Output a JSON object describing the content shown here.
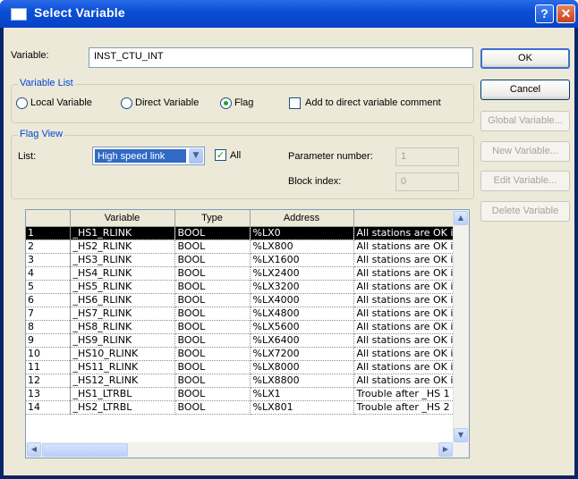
{
  "window": {
    "title": "Select Variable",
    "help_glyph": "?",
    "close_glyph": "✕"
  },
  "variable": {
    "label": "Variable:",
    "value": "INST_CTU_INT"
  },
  "variable_list": {
    "title": "Variable List",
    "options": [
      "Local Variable",
      "Direct Variable",
      "Flag"
    ],
    "selected": "Flag",
    "add_comment_label": "Add to direct variable comment",
    "add_comment_checked": false
  },
  "flag_view": {
    "title": "Flag View",
    "list_label": "List:",
    "list_value": "High speed link",
    "all_label": "All",
    "all_checked": true,
    "param_label": "Parameter number:",
    "param_value": "1",
    "block_label": "Block index:",
    "block_value": "0"
  },
  "buttons": {
    "ok": "OK",
    "cancel": "Cancel",
    "global": "Global Variable...",
    "new": "New Variable...",
    "edit": "Edit Variable...",
    "delete": "Delete Variable"
  },
  "table": {
    "columns": [
      "",
      "Variable",
      "Type",
      "Address",
      ""
    ],
    "rows": [
      [
        "1",
        "_HS1_RLINK",
        "BOOL",
        "%LX0",
        "All stations are OK i"
      ],
      [
        "2",
        "_HS2_RLINK",
        "BOOL",
        "%LX800",
        "All stations are OK i"
      ],
      [
        "3",
        "_HS3_RLINK",
        "BOOL",
        "%LX1600",
        "All stations are OK i"
      ],
      [
        "4",
        "_HS4_RLINK",
        "BOOL",
        "%LX2400",
        "All stations are OK i"
      ],
      [
        "5",
        "_HS5_RLINK",
        "BOOL",
        "%LX3200",
        "All stations are OK i"
      ],
      [
        "6",
        "_HS6_RLINK",
        "BOOL",
        "%LX4000",
        "All stations are OK i"
      ],
      [
        "7",
        "_HS7_RLINK",
        "BOOL",
        "%LX4800",
        "All stations are OK i"
      ],
      [
        "8",
        "_HS8_RLINK",
        "BOOL",
        "%LX5600",
        "All stations are OK i"
      ],
      [
        "9",
        "_HS9_RLINK",
        "BOOL",
        "%LX6400",
        "All stations are OK i"
      ],
      [
        "10",
        "_HS10_RLINK",
        "BOOL",
        "%LX7200",
        "All stations are OK i"
      ],
      [
        "11",
        "_HS11_RLINK",
        "BOOL",
        "%LX8000",
        "All stations are OK i"
      ],
      [
        "12",
        "_HS12_RLINK",
        "BOOL",
        "%LX8800",
        "All stations are OK i"
      ],
      [
        "13",
        "_HS1_LTRBL",
        "BOOL",
        "%LX1",
        "Trouble after _HS 1"
      ],
      [
        "14",
        "_HS2_LTRBL",
        "BOOL",
        "%LX801",
        "Trouble after _HS 2"
      ]
    ],
    "selected_row": 0
  },
  "scroll_glyphs": {
    "up": "▲",
    "down": "▼",
    "left": "◀",
    "right": "▶",
    "combo": "▼",
    "grip": "|||"
  }
}
